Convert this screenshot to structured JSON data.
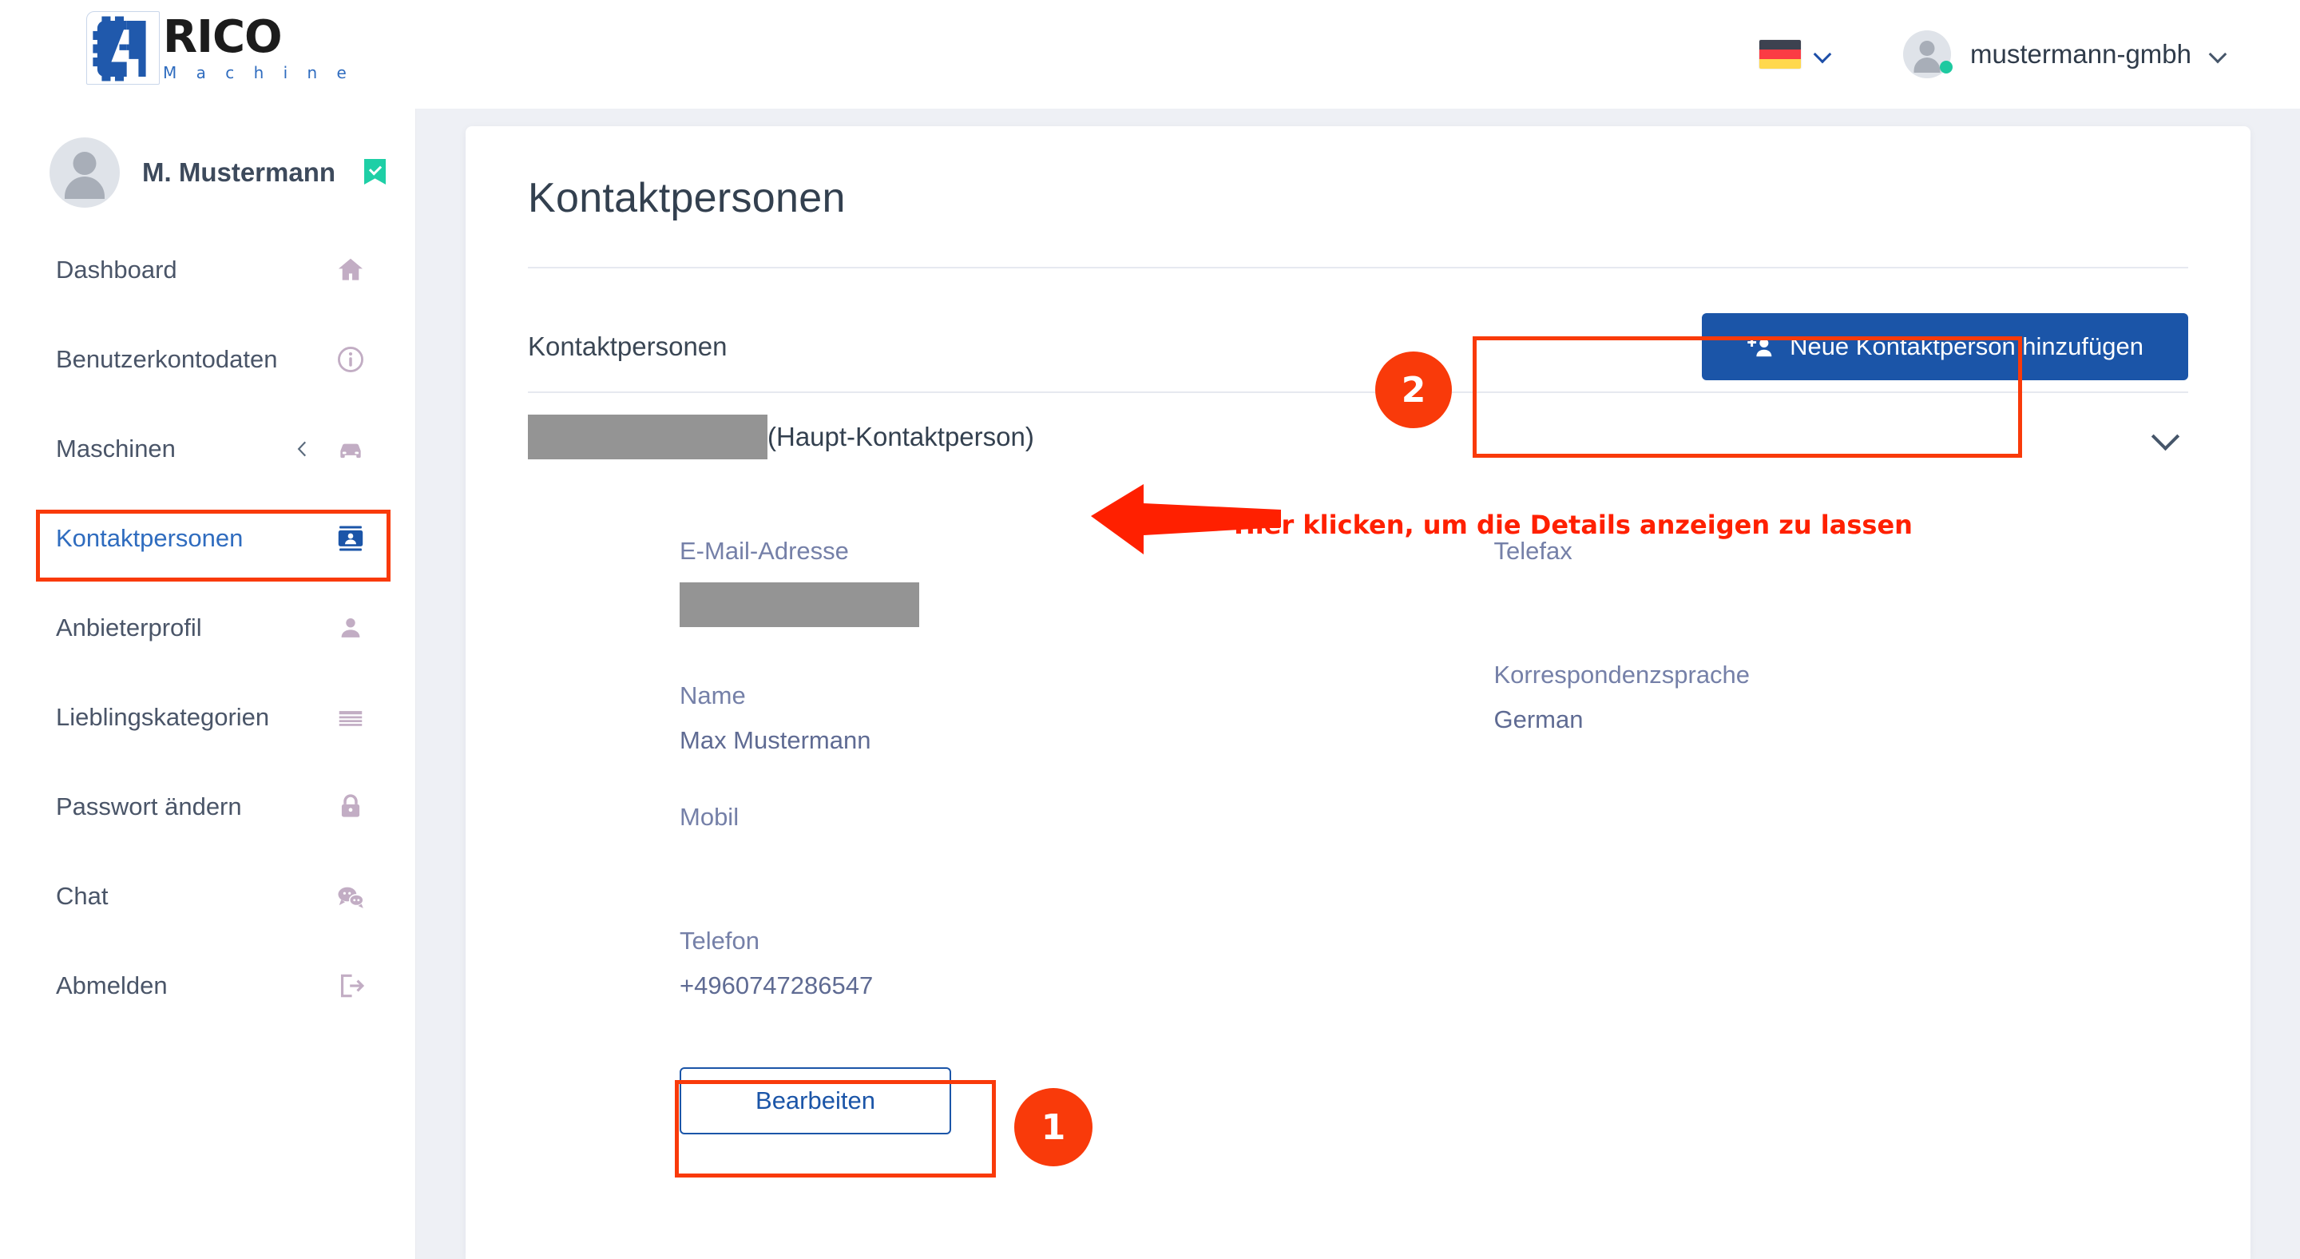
{
  "brand": {
    "name_primary": "RICO",
    "name_secondary": "M a c h i n e",
    "logo_icon": "gear-a-logo"
  },
  "topbar": {
    "language_flag": "german-flag-icon",
    "language_chevron": "chevron-down-icon",
    "account_name": "mustermann-gmbh",
    "account_chevron": "chevron-down-icon",
    "avatar_icon": "user-avatar-icon",
    "status_dot": "online-status-dot"
  },
  "sidebar": {
    "user": {
      "name": "M. Mustermann",
      "avatar_icon": "user-avatar-icon",
      "verified_icon": "verified-badge-icon"
    },
    "items": [
      {
        "label": "Dashboard",
        "icon": "home-icon",
        "active": false,
        "expand": false
      },
      {
        "label": "Benutzerkontodaten",
        "icon": "info-circle-icon",
        "active": false,
        "expand": false
      },
      {
        "label": "Maschinen",
        "icon": "car-icon",
        "active": false,
        "expand": true,
        "expand_icon": "chevron-left-icon"
      },
      {
        "label": "Kontaktpersonen",
        "icon": "contact-card-icon",
        "active": true,
        "expand": false
      },
      {
        "label": "Anbieterprofil",
        "icon": "person-icon",
        "active": false,
        "expand": false
      },
      {
        "label": "Lieblingskategorien",
        "icon": "list-lines-icon",
        "active": false,
        "expand": false
      },
      {
        "label": "Passwort ändern",
        "icon": "lock-icon",
        "active": false,
        "expand": false
      },
      {
        "label": "Chat",
        "icon": "chat-bubbles-icon",
        "active": false,
        "expand": false
      },
      {
        "label": "Abmelden",
        "icon": "logout-icon",
        "active": false,
        "expand": false
      }
    ]
  },
  "main": {
    "page_title": "Kontaktpersonen",
    "section_title": "Kontaktpersonen",
    "add_button": {
      "label": "Neue Kontaktperson hinzufügen",
      "icon": "add-person-icon"
    },
    "contact_row": {
      "name_value": "[redacted]",
      "role_suffix": "(Haupt-Kontaktperson)",
      "toggle_icon": "chevron-down-icon"
    },
    "details": {
      "left": [
        {
          "label": "E-Mail-Adresse",
          "value": "[redacted]",
          "redacted": true
        },
        {
          "label": "Name",
          "value": "Max Mustermann",
          "redacted": false
        },
        {
          "label": "Mobil",
          "value": "",
          "redacted": false
        },
        {
          "label": "Telefon",
          "value": "+4960747286547",
          "redacted": false
        }
      ],
      "right": [
        {
          "label": "Telefax",
          "value": "",
          "redacted": false
        },
        {
          "label": "Korrespondenzsprache",
          "value": "German",
          "redacted": false
        }
      ]
    },
    "edit_button": {
      "label": "Bearbeiten"
    }
  },
  "annotations": {
    "badge_one": "1",
    "badge_two": "2",
    "arrow_text": "Hier klicken, um die Details anzeigen zu lassen",
    "highlight_color": "#f93a0a",
    "arrow_color": "#ff2000",
    "text_color": "#ff2000"
  },
  "colors": {
    "primary_blue": "#1b55a8",
    "link_blue": "#2f6cbf",
    "label_purple": "#7580a8",
    "value_purple": "#5f6b93",
    "page_bg": "#eef0f5",
    "redaction_gray": "#949494",
    "verified_green": "#1ecfa6"
  }
}
